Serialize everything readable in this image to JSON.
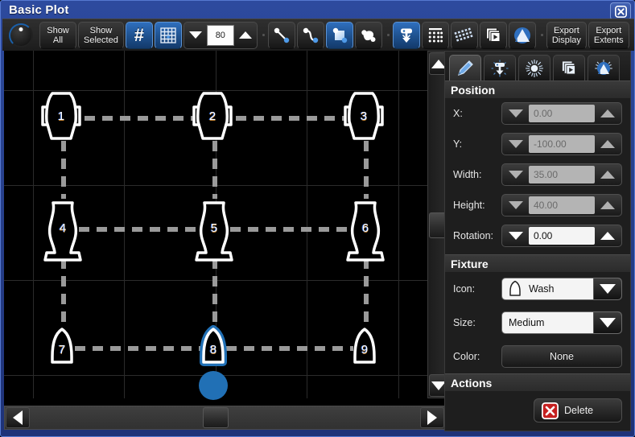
{
  "window": {
    "title": "Basic Plot",
    "close_icon": "close-icon"
  },
  "toolbar": {
    "knob_icon": "rotary-knob-icon",
    "show_all_line1": "Show",
    "show_all_line2": "All",
    "show_selected_line1": "Show",
    "show_selected_line2": "Selected",
    "number_icon": "hash-number-icon",
    "grid_icon": "grid-icon",
    "spinner_value": "80",
    "spinner_down_icon": "triangle-down-icon",
    "spinner_up_icon": "triangle-up-icon",
    "line_tool_icon": "line-tool-icon",
    "curve_tool_icon": "curve-tool-icon",
    "rect_tool_icon": "rectangle-tool-icon",
    "blob_tool_icon": "freeform-tool-icon",
    "fixture_place_icon": "fixture-place-icon",
    "dot_grid_icon": "dot-grid-icon",
    "perspective_grid_icon": "perspective-grid-icon",
    "layers_play_icon": "layers-play-icon",
    "arch_icon": "arch-shape-icon",
    "export_display_line1": "Export",
    "export_display_line2": "Display",
    "export_extents_line1": "Export",
    "export_extents_line2": "Extents"
  },
  "plot": {
    "background": "#000000",
    "gridline_color": "#2b2b2b",
    "connector_color": "#9a9a9a",
    "fixture_outline": "#ffffff",
    "selection_color": "#2170b5",
    "fixtures": [
      {
        "label": "1",
        "type": "moving-head",
        "col": 0,
        "row": 0,
        "selected": false
      },
      {
        "label": "2",
        "type": "moving-head",
        "col": 1,
        "row": 0,
        "selected": false
      },
      {
        "label": "3",
        "type": "moving-head",
        "col": 2,
        "row": 0,
        "selected": false
      },
      {
        "label": "4",
        "type": "wash-tall",
        "col": 0,
        "row": 1,
        "selected": false
      },
      {
        "label": "5",
        "type": "wash-tall",
        "col": 1,
        "row": 1,
        "selected": false
      },
      {
        "label": "6",
        "type": "wash-tall",
        "col": 2,
        "row": 1,
        "selected": false
      },
      {
        "label": "7",
        "type": "wash",
        "col": 0,
        "row": 2,
        "selected": false
      },
      {
        "label": "8",
        "type": "wash",
        "col": 1,
        "row": 2,
        "selected": true
      },
      {
        "label": "9",
        "type": "wash",
        "col": 2,
        "row": 2,
        "selected": false
      }
    ],
    "rotation_handle_icon": "rotation-handle"
  },
  "scrollbars": {
    "v_up_icon": "triangle-up-icon",
    "v_down_icon": "triangle-down-icon",
    "h_left_icon": "triangle-left-icon",
    "h_right_icon": "triangle-right-icon",
    "v_thumb_icon": "scroll-thumb",
    "h_thumb_icon": "scroll-thumb"
  },
  "panel": {
    "tabs": [
      {
        "name": "tab-edit",
        "icon": "pencil-icon",
        "active": true
      },
      {
        "name": "tab-fixture",
        "icon": "fixture-icon",
        "active": false
      },
      {
        "name": "tab-effects",
        "icon": "sparkle-icon",
        "active": false
      },
      {
        "name": "tab-layers",
        "icon": "layers-play-icon",
        "active": false
      },
      {
        "name": "tab-beams",
        "icon": "beam-arch-icon",
        "active": false
      }
    ],
    "position": {
      "header": "Position",
      "fields": [
        {
          "label": "X:",
          "value": "0.00",
          "enabled": false
        },
        {
          "label": "Y:",
          "value": "-100.00",
          "enabled": false
        },
        {
          "label": "Width:",
          "value": "35.00",
          "enabled": false
        },
        {
          "label": "Height:",
          "value": "40.00",
          "enabled": false
        },
        {
          "label": "Rotation:",
          "value": "0.00",
          "enabled": true
        }
      ]
    },
    "fixture": {
      "header": "Fixture",
      "icon_label": "Icon:",
      "icon_value": "Wash",
      "icon_glyph": "wash-fixture-icon",
      "size_label": "Size:",
      "size_value": "Medium",
      "color_label": "Color:",
      "color_value": "None",
      "dropdown_icon": "chevron-down-icon"
    },
    "actions": {
      "header": "Actions",
      "delete_label": "Delete",
      "delete_icon": "delete-x-icon"
    }
  }
}
